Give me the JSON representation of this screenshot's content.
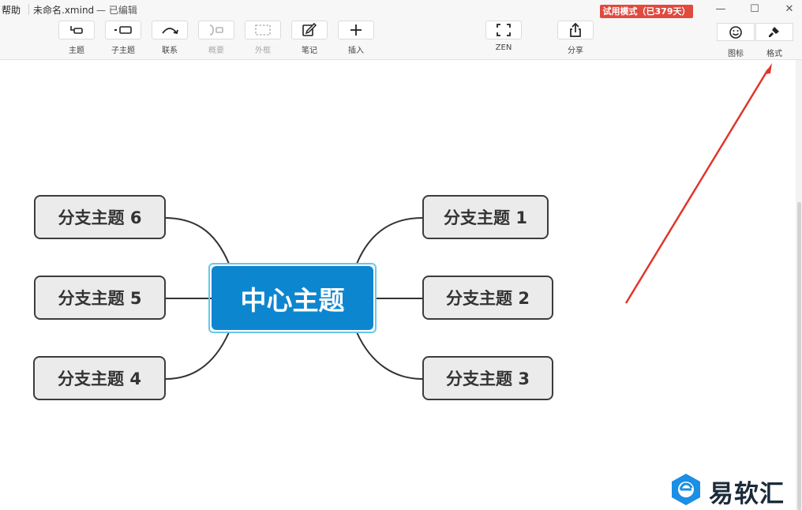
{
  "titlebar": {
    "help": "帮助",
    "doc_name": "未命名.xmind",
    "doc_status": "— 已编辑",
    "trial_badge": "试用模式（已379天）",
    "minimize": "—",
    "maximize": "☐",
    "close": "✕"
  },
  "toolbar": {
    "topic": "主题",
    "subtopic": "子主题",
    "relationship": "联系",
    "summary": "概要",
    "boundary": "外框",
    "note": "笔记",
    "insert": "插入",
    "zen": "ZEN",
    "share": "分享",
    "icons": "图标",
    "format": "格式"
  },
  "mindmap": {
    "central": "中心主题",
    "branches": [
      "分支主题 1",
      "分支主题 2",
      "分支主题 3",
      "分支主题 4",
      "分支主题 5",
      "分支主题 6"
    ]
  },
  "watermark": {
    "text": "易软汇"
  },
  "colors": {
    "central_fill": "#0d86d0",
    "selection": "#66c8ec",
    "trial_badge": "#e04a3f",
    "arrow": "#e0362c"
  }
}
